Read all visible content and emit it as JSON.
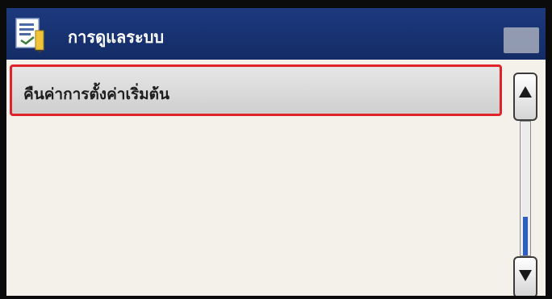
{
  "window": {
    "title": "การดูแลระบบ",
    "title_icon": "settings-document-icon"
  },
  "list": {
    "items": [
      {
        "label": "คืนค่าการตั้งค่าเริ่มต้น",
        "selected": true
      }
    ]
  },
  "scrollbar": {
    "up_icon": "triangle-up-icon",
    "down_icon": "triangle-down-icon"
  },
  "colors": {
    "titlebar": "#1d3a7e",
    "selection_border": "#e0232b",
    "scroll_thumb": "#2c5fc0"
  }
}
